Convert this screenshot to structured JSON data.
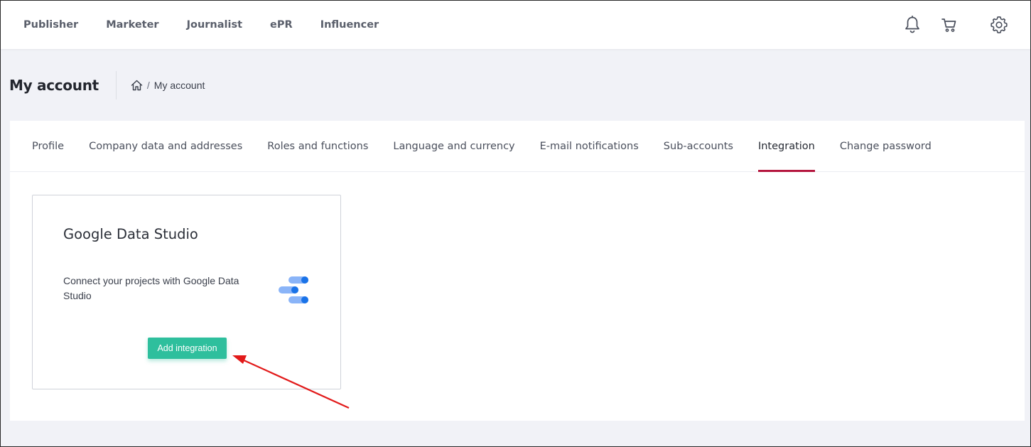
{
  "topnav": {
    "items": [
      "Publisher",
      "Marketer",
      "Journalist",
      "ePR",
      "Influencer"
    ]
  },
  "topicons": [
    "bell-icon",
    "cart-icon",
    "gear-icon"
  ],
  "header": {
    "title": "My account",
    "breadcrumb": {
      "home_icon": "home-icon",
      "separator": "/",
      "current": "My account"
    }
  },
  "tabs": {
    "items": [
      "Profile",
      "Company data and addresses",
      "Roles and functions",
      "Language and currency",
      "E-mail notifications",
      "Sub-accounts",
      "Integration",
      "Change password"
    ],
    "active": "Integration"
  },
  "integration_card": {
    "title": "Google Data Studio",
    "description": "Connect your projects with Google Data Studio",
    "logo_icon": "google-data-studio-logo-icon",
    "button_label": "Add integration"
  },
  "colors": {
    "accent_tab": "#b5173f",
    "button": "#2ebf9d",
    "annotation_arrow": "#e21a1a",
    "logo_light": "#8ab4f8",
    "logo_dark": "#1a73e8"
  }
}
